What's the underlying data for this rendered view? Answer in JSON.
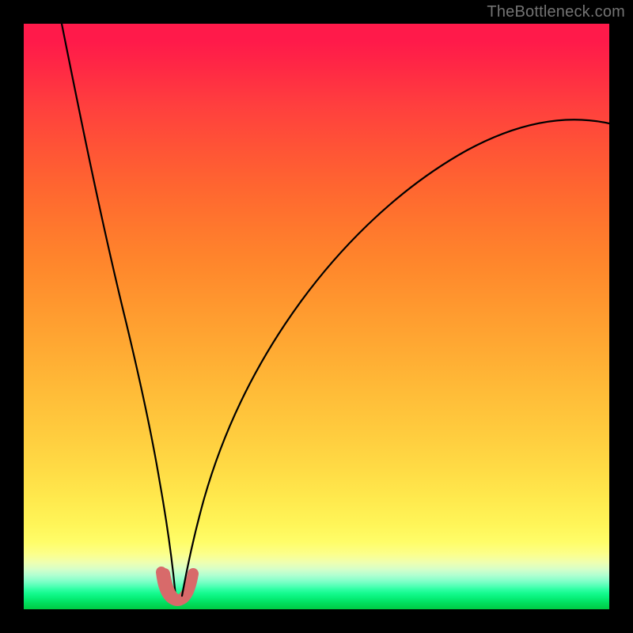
{
  "watermark": "TheBottleneck.com",
  "colors": {
    "top": "#ff1a4a",
    "mid": "#ffcc3e",
    "bottom": "#00ca43",
    "blob": "#d86a6a",
    "frame": "#000000"
  },
  "chart_data": {
    "type": "line",
    "title": "",
    "xlabel": "",
    "ylabel": "",
    "xlim": [
      0,
      100
    ],
    "ylim": [
      0,
      100
    ],
    "grid": false,
    "legend": false,
    "series": [
      {
        "name": "left-curve",
        "x": [
          6.5,
          8,
          10,
          12,
          14,
          16,
          18,
          20,
          21,
          22,
          22.5,
          23,
          23.5,
          24,
          24.5,
          25,
          25.5
        ],
        "y": [
          100,
          87,
          73,
          60,
          49,
          39,
          30,
          22,
          18,
          14.5,
          12.5,
          10.5,
          8.5,
          6.5,
          4.5,
          3,
          2.2
        ]
      },
      {
        "name": "right-curve",
        "x": [
          27.5,
          28,
          28.5,
          29.5,
          31,
          33,
          36,
          40,
          45,
          51,
          58,
          66,
          75,
          85,
          95,
          100
        ],
        "y": [
          2.2,
          3,
          4.5,
          7,
          11,
          16,
          23,
          31,
          40,
          49,
          57,
          64.5,
          71,
          76.5,
          81,
          83
        ]
      },
      {
        "name": "blob-outline",
        "x": [
          23.2,
          24.0,
          25.0,
          26.0,
          26.8,
          28.0,
          29.2,
          29.8,
          29.6,
          28.9,
          27.7,
          26.5,
          25.3,
          24.2,
          23.4,
          23.1,
          23.2
        ],
        "y": [
          6.0,
          4.0,
          2.6,
          1.8,
          1.5,
          1.7,
          2.8,
          4.5,
          6.0,
          4.3,
          3.1,
          2.7,
          3.0,
          3.8,
          5.0,
          6.0,
          6.0
        ]
      }
    ],
    "annotations": [
      {
        "text": "TheBottleneck.com",
        "position": "top-right"
      }
    ]
  }
}
